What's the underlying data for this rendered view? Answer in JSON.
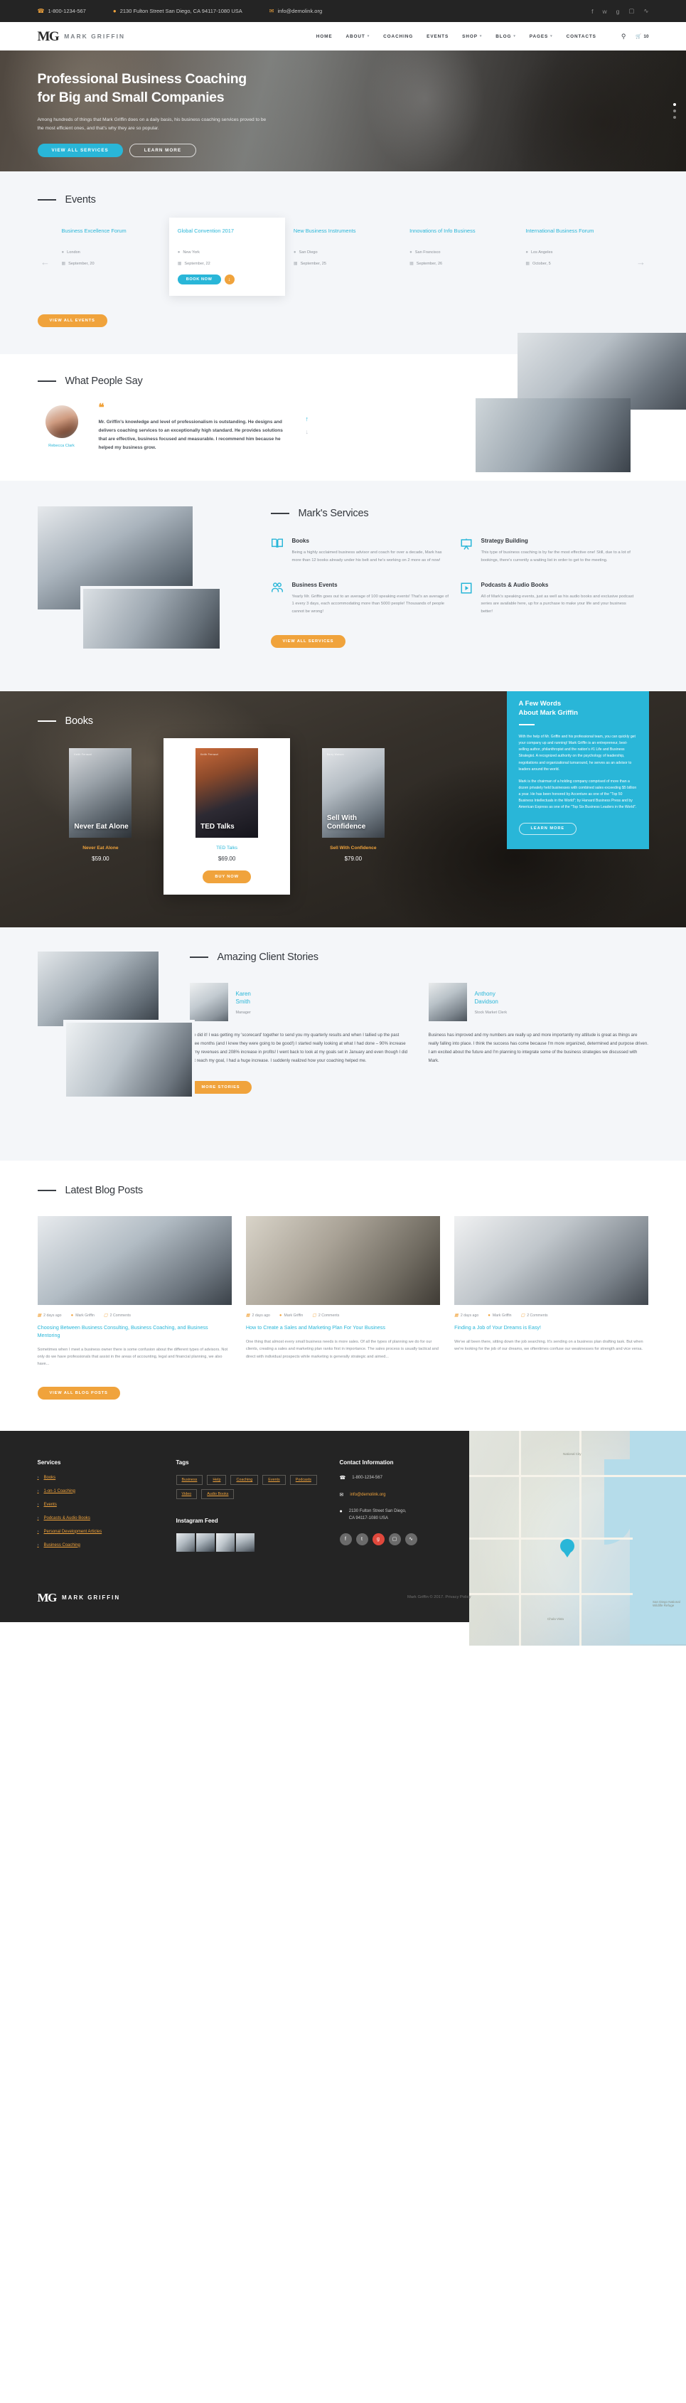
{
  "topbar": {
    "phone": "1-800-1234-567",
    "address": "2130 Fulton Street San Diego, CA 94117-1080 USA",
    "email": "info@demolink.org",
    "socials": [
      "facebook-icon",
      "twitter-icon",
      "google-plus-icon",
      "instagram-icon",
      "rss-icon"
    ]
  },
  "header": {
    "logo_mark": "MG",
    "logo_text": "MARK GRIFFIN",
    "menu": [
      {
        "label": "HOME",
        "caret": false
      },
      {
        "label": "ABOUT",
        "caret": true
      },
      {
        "label": "COACHING",
        "caret": false
      },
      {
        "label": "EVENTS",
        "caret": false
      },
      {
        "label": "SHOP",
        "caret": true
      },
      {
        "label": "BLOG",
        "caret": true
      },
      {
        "label": "PAGES",
        "caret": true
      },
      {
        "label": "CONTACTS",
        "caret": false
      }
    ],
    "cart_count": "10"
  },
  "hero": {
    "title_line1": "Professional Business Coaching",
    "title_line2": "for Big and Small Companies",
    "paragraph": "Among hundreds of things that Mark Griffin does on a daily basis, his business coaching services proved to be the most efficient ones, and that's why they are so popular.",
    "btn_primary": "VIEW ALL SERVICES",
    "btn_secondary": "LEARN MORE"
  },
  "events": {
    "title": "Events",
    "prev": "←",
    "next": "→",
    "items": [
      {
        "name": "Business Excellence Forum",
        "city": "London",
        "date": "September, 20",
        "active": false
      },
      {
        "name": "Global Convention 2017",
        "city": "New York",
        "date": "September, 22",
        "active": true
      },
      {
        "name": "New Business Instruments",
        "city": "San Diego",
        "date": "September, 25",
        "active": false
      },
      {
        "name": "Innovations of Info Business",
        "city": "San Francisco",
        "date": "September, 26",
        "active": false
      },
      {
        "name": "International Business Forum",
        "city": "Los Angeles",
        "date": "October, 5",
        "active": false
      }
    ],
    "book_label": "BOOK NOW",
    "view_all": "VIEW ALL EVENTS"
  },
  "testimonial": {
    "title": "What People Say",
    "quote_glyph": "“",
    "text": "Mr. Griffin's knowledge and level of professionalism is outstanding. He designs and delivers coaching services to an exceptionally high standard. He provides solutions that are effective, business focused and measurable. I recommend him because he helped my business grow.",
    "author": "Rebecca Clark"
  },
  "services": {
    "title": "Mark's Services",
    "items": [
      {
        "icon": "book-icon",
        "name": "Books",
        "text": "Being a highly acclaimed business advisor and coach for over a decade, Mark has more than 12 books already under his belt and he's working on 2 more as of now!"
      },
      {
        "icon": "presentation-board-icon",
        "name": "Strategy Building",
        "text": "This type of business coaching is by far the most effective one! Still, due to a lot of bookings, there's currently a waiting list in order to get to the meeting."
      },
      {
        "icon": "people-icon",
        "name": "Business Events",
        "text": "Yearly Mr. Griffin goes out to an average of 100 speaking events! That's an average of 1 every 3 days, each accommodating more than 5000 people! Thousands of people cannot be wrong!"
      },
      {
        "icon": "play-box-icon",
        "name": "Podcasts & Audio Books",
        "text": "All of Mark's speaking events, just as well as his audio books and exclusive podcast series are available here, up for a purchase to make your life and your business better!"
      }
    ],
    "view_all": "VIEW ALL SERVICES"
  },
  "books": {
    "title": "Books",
    "items": [
      {
        "cover_author": "Keith Ferrazzi",
        "cover_title": "Never Eat Alone",
        "name": "Never Eat Alone",
        "price": "$59.00",
        "active": false
      },
      {
        "cover_author": "Keith Ferrazzi",
        "cover_title": "TED Talks",
        "name": "TED Talks",
        "price": "$69.00",
        "active": true
      },
      {
        "cover_author": "Barry Watson",
        "cover_title": "Sell With Confidence",
        "name": "Sell With Confidence",
        "price": "$79.00",
        "active": false
      }
    ],
    "buy_label": "BUY NOW"
  },
  "about_panel": {
    "title_line1": "A Few Words",
    "title_line2": "About Mark Griffin",
    "paragraph1": "With the help of Mr. Griffin and his professional team, you can quickly get your company up and running! Mark Griffin is an entrepreneur, best-selling author, philanthropist and the nation's #1 Life and Business Strategist. A recognized authority on the psychology of leadership, negotiations and organizational turnaround, he serves as an advisor to leaders around the world.",
    "paragraph2": "Mark is the chairman of a holding company comprised of more than a dozen privately held businesses with combined sales exceeding $5 billion a year. He has been honored by Accenture as one of the \"Top 50 Business Intellectuals in the World\"; by Harvard Business Press and by American Express as one of the \"Top Six Business Leaders in the World\".",
    "btn": "LEARN MORE"
  },
  "stories": {
    "title": "Amazing Client Stories",
    "items": [
      {
        "name_line1": "Karen",
        "name_line2": "Smith",
        "role": "Manager",
        "text": "We did it! I was getting my 'scorecard' together to send you my quarterly results and when I tallied up the past three months (and I knew they were going to be good!) I started really looking at what I had done – 90% increase in my revenues and 208% increase in profits! I went back to look at my goals set in January and even though I did not reach my goal, I had a huge increase. I suddenly realized how your coaching helped me."
      },
      {
        "name_line1": "Anthony",
        "name_line2": "Davidson",
        "role": "Stock Market Clerk",
        "text": "Business has improved and my numbers are really up and more importantly my attitude is great as things are really falling into place. I think the success has come because I'm more organized, determined and purpose driven. I am excited about the future and I'm planning to integrate some of the business strategies we discussed with Mark."
      }
    ],
    "more": "MORE STORIES"
  },
  "blog": {
    "title": "Latest Blog Posts",
    "posts": [
      {
        "date": "2 days ago",
        "author": "Mark Griffin",
        "comments": "2 Comments",
        "title": "Choosing Between Business Consulting, Business Coaching, and Business Mentoring",
        "excerpt": "Sometimes when I meet a business owner there is some confusion about the different types of advisors. Not only do we have professionals that assist in the areas of accounting, legal and financial planning, we also have..."
      },
      {
        "date": "2 days ago",
        "author": "Mark Griffin",
        "comments": "2 Comments",
        "title": "How to Create a Sales and Marketing Plan For Your Business",
        "excerpt": "One thing that almost every small business needs is more sales. Of all the types of planning we do for our clients, creating a sales and marketing plan ranks first in importance. The sales process is usually tactical and direct with individual prospects while marketing is generally strategic and aimed..."
      },
      {
        "date": "2 days ago",
        "author": "Mark Griffin",
        "comments": "2 Comments",
        "title": "Finding a Job of Your Dreams is Easy!",
        "excerpt": "We've all been there, sitting down the job searching. It's sending on a business plan drafting task. But when we're looking for the job of our dreams, we oftentimes confuse our weaknesses for strength and vice versa."
      }
    ],
    "view_all": "VIEW ALL BLOG POSTS"
  },
  "footer": {
    "services_title": "Services",
    "services": [
      "Books",
      "1-on-1 Coaching",
      "Events",
      "Podcasts & Audio Books",
      "Personal Development Articles",
      "Business Coaching"
    ],
    "tags_title": "Tags",
    "tags": [
      "Business",
      "Help",
      "Coaching",
      "Events",
      "Podcasts",
      "Video",
      "Audio Books"
    ],
    "instagram_title": "Instagram Feed",
    "contact_title": "Contact Information",
    "phone": "1-800-1234-567",
    "email": "info@demolink.org",
    "address_line1": "2130 Fulton Street San Diego,",
    "address_line2": "CA 94117-1080 USA",
    "socials": [
      "facebook-icon",
      "twitter-icon",
      "google-plus-icon",
      "instagram-icon",
      "rss-icon"
    ],
    "logo_mark": "MG",
    "logo_text": "MARK GRIFFIN",
    "copyright": "Mark Griffin © 2017. Privacy Policy",
    "map_labels": [
      "National City",
      "Chula Vista",
      "San Diego National Wildlife Refuge"
    ]
  }
}
